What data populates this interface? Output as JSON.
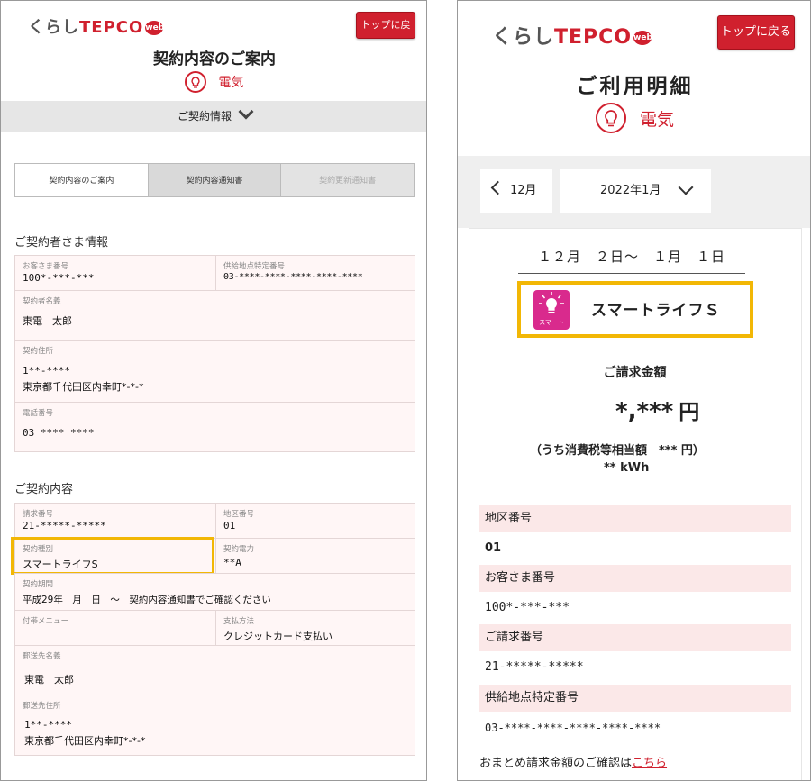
{
  "logo": {
    "kurashi": "くらし",
    "tepco": "TEPCO",
    "web": "web"
  },
  "left": {
    "top_button": "トップに戻る",
    "title": "契約内容のご案内",
    "service": "電気",
    "accordion": "ご契約情報",
    "tabs": [
      "契約内容のご案内",
      "契約内容通知書",
      "契約更新通知書"
    ],
    "section1": "ご契約者さま情報",
    "customer_no_label": "お客さま番号",
    "customer_no": "100*-***-***",
    "supply_point_label": "供給地点特定番号",
    "supply_point": "03-****-****-****-****-****",
    "contractor_label": "契約者名義",
    "contractor": "東電　太郎",
    "address_label": "契約住所",
    "postal": "1**-****",
    "address": "東京都千代田区内幸町*-*-*",
    "phone_label": "電話番号",
    "phone": "03 **** ****",
    "section2": "ご契約内容",
    "billing_no_label": "請求番号",
    "billing_no": "21-*****-*****",
    "district_label": "地区番号",
    "district": "01",
    "contract_type_label": "契約種別",
    "contract_type": "スマートライフS",
    "contract_power_label": "契約電力",
    "contract_power": "**A",
    "period_label": "契約期間",
    "period": "平成29年　月　日　～　契約内容通知書でご確認ください",
    "addon_label": "付帯メニュー",
    "payment_label": "支払方法",
    "payment": "クレジットカード支払い",
    "mail_name_label": "郵送先名義",
    "mail_name": "東電　太郎",
    "mail_address_label": "郵送先住所",
    "mail_postal": "1**-****",
    "mail_address": "東京都千代田区内幸町*-*-*"
  },
  "right": {
    "top_button": "トップに戻る",
    "title": "ご利用明細",
    "service": "電気",
    "prev_month": "12月",
    "month": "2022年1月",
    "period": "１２月　２日～　１月　１日",
    "plan_icon_text": "スマート",
    "plan_name": "スマートライフＳ",
    "bill_label": "ご請求金額",
    "bill_amount": "*,***",
    "yen": "円",
    "tax": "（うち消費税等相当額　*** 円）",
    "kwh": "** kWh",
    "district_label": "地区番号",
    "district": "01",
    "customer_no_label": "お客さま番号",
    "customer_no": "100*-***-***",
    "billing_no_label": "ご請求番号",
    "billing_no": "21-*****-*****",
    "supply_point_label": "供給地点特定番号",
    "supply_point": "03-****-****-****-****-****",
    "note_text": "おまとめ請求金額のご確認は",
    "note_link": "こちら"
  },
  "colors": {
    "accent": "#d0202e",
    "highlight": "#f2b705",
    "smart": "#d92a8d"
  }
}
